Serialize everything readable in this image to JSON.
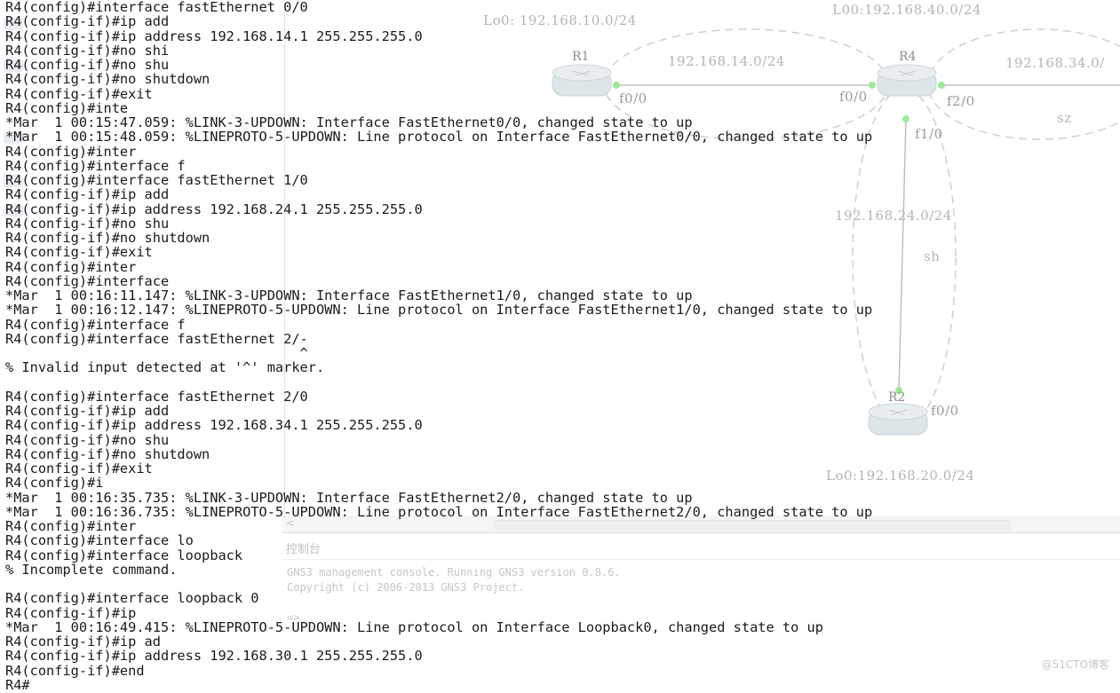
{
  "topology": {
    "routers": [
      {
        "name": "R1"
      },
      {
        "name": "R4"
      },
      {
        "name": "R2"
      }
    ],
    "labels": {
      "lo0_r1": "Lo0: 192.168.10.0/24",
      "lo0_r4": "L00:192.168.40.0/24",
      "lo0_r2": "Lo0:192.168.20.0/24",
      "net_14": "192.168.14.0/24",
      "net_34": "192.168.34.0/",
      "net_24": "192.168.24.0/24",
      "if_r1_f00": "f0/0",
      "if_r4_f00": "f0/0",
      "if_r4_f20": "f2/0",
      "if_r4_f10": "f1/0",
      "if_r2_f00": "f0/0",
      "area_sz": "sz",
      "area_sh": "sh"
    }
  },
  "console": {
    "title": "控制台",
    "lines": [
      "GNS3 management console. Running GNS3 version 0.8.6.",
      "Copyright (c) 2006-2013 GNS3 Project.",
      "",
      "=>"
    ],
    "scroll_left": "<"
  },
  "terminal": {
    "lines": [
      "R4(config)#interface fastEthernet 0/0",
      "R4(config-if)#ip add",
      "R4(config-if)#ip address 192.168.14.1 255.255.255.0",
      "R4(config-if)#no shi",
      "R4(config-if)#no shu",
      "R4(config-if)#no shutdown",
      "R4(config-if)#exit",
      "R4(config)#inte",
      "*Mar  1 00:15:47.059: %LINK-3-UPDOWN: Interface FastEthernet0/0, changed state to up",
      "*Mar  1 00:15:48.059: %LINEPROTO-5-UPDOWN: Line protocol on Interface FastEthernet0/0, changed state to up",
      "R4(config)#inter",
      "R4(config)#interface f",
      "R4(config)#interface fastEthernet 1/0",
      "R4(config-if)#ip add",
      "R4(config-if)#ip address 192.168.24.1 255.255.255.0",
      "R4(config-if)#no shu",
      "R4(config-if)#no shutdown",
      "R4(config-if)#exit",
      "R4(config)#inter",
      "R4(config)#interface",
      "*Mar  1 00:16:11.147: %LINK-3-UPDOWN: Interface FastEthernet1/0, changed state to up",
      "*Mar  1 00:16:12.147: %LINEPROTO-5-UPDOWN: Line protocol on Interface FastEthernet1/0, changed state to up",
      "R4(config)#interface f",
      "R4(config)#interface fastEthernet 2/-",
      "                                    ^",
      "% Invalid input detected at '^' marker.",
      "",
      "R4(config)#interface fastEthernet 2/0",
      "R4(config-if)#ip add",
      "R4(config-if)#ip address 192.168.34.1 255.255.255.0",
      "R4(config-if)#no shu",
      "R4(config-if)#no shutdown",
      "R4(config-if)#exit",
      "R4(config)#i",
      "*Mar  1 00:16:35.735: %LINK-3-UPDOWN: Interface FastEthernet2/0, changed state to up",
      "*Mar  1 00:16:36.735: %LINEPROTO-5-UPDOWN: Line protocol on Interface FastEthernet2/0, changed state to up",
      "R4(config)#inter",
      "R4(config)#interface lo",
      "R4(config)#interface loopback",
      "% Incomplete command.",
      "",
      "R4(config)#interface loopback 0",
      "R4(config-if)#ip",
      "*Mar  1 00:16:49.415: %LINEPROTO-5-UPDOWN: Line protocol on Interface Loopback0, changed state to up",
      "R4(config-if)#ip ad",
      "R4(config-if)#ip address 192.168.30.1 255.255.255.0",
      "R4(config-if)#end",
      "R4#"
    ]
  },
  "watermark": "@51CTO博客",
  "colors": {
    "terminal_text": "#1a1a1a",
    "topology_faded": "#b4b4b4",
    "router_body": "#d9e2e6",
    "link_dot": "#8fe08f"
  }
}
